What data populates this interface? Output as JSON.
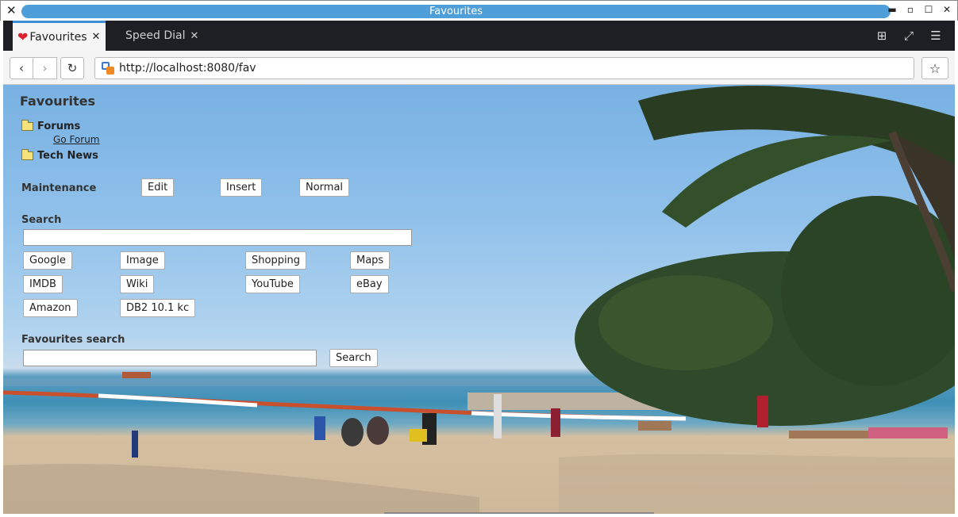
{
  "window": {
    "title": "Favourites",
    "controls": [
      "minimize",
      "restore",
      "maximize",
      "close"
    ]
  },
  "tabs": [
    {
      "label": "Favourites",
      "icon": "heart-icon",
      "active": true
    },
    {
      "label": "Speed Dial",
      "icon": null,
      "active": false
    }
  ],
  "toolbar_icons": [
    "new-window-icon",
    "fullscreen-icon",
    "menu-icon"
  ],
  "nav": {
    "url": "http://localhost:8080/fav"
  },
  "page": {
    "title": "Favourites",
    "folders": [
      {
        "name": "Forums",
        "links": [
          "Go Forum"
        ]
      },
      {
        "name": "Tech News",
        "links": []
      }
    ],
    "maintenance": {
      "label": "Maintenance",
      "buttons": [
        "Edit",
        "Insert",
        "Normal"
      ]
    },
    "search": {
      "label": "Search",
      "input_value": "",
      "engines": [
        "Google",
        "Image",
        "Shopping",
        "Maps",
        "IMDB",
        "Wiki",
        "YouTube",
        "eBay",
        "Amazon",
        "DB2 10.1 kc"
      ]
    },
    "fav_search": {
      "label": "Favourites search",
      "input_value": "",
      "button": "Search"
    }
  },
  "colors": {
    "title_pill": "#4e9fd9",
    "tabbar_bg": "#1e1f24",
    "active_tab_accent": "#3d8fd8",
    "heart": "#e02030"
  }
}
